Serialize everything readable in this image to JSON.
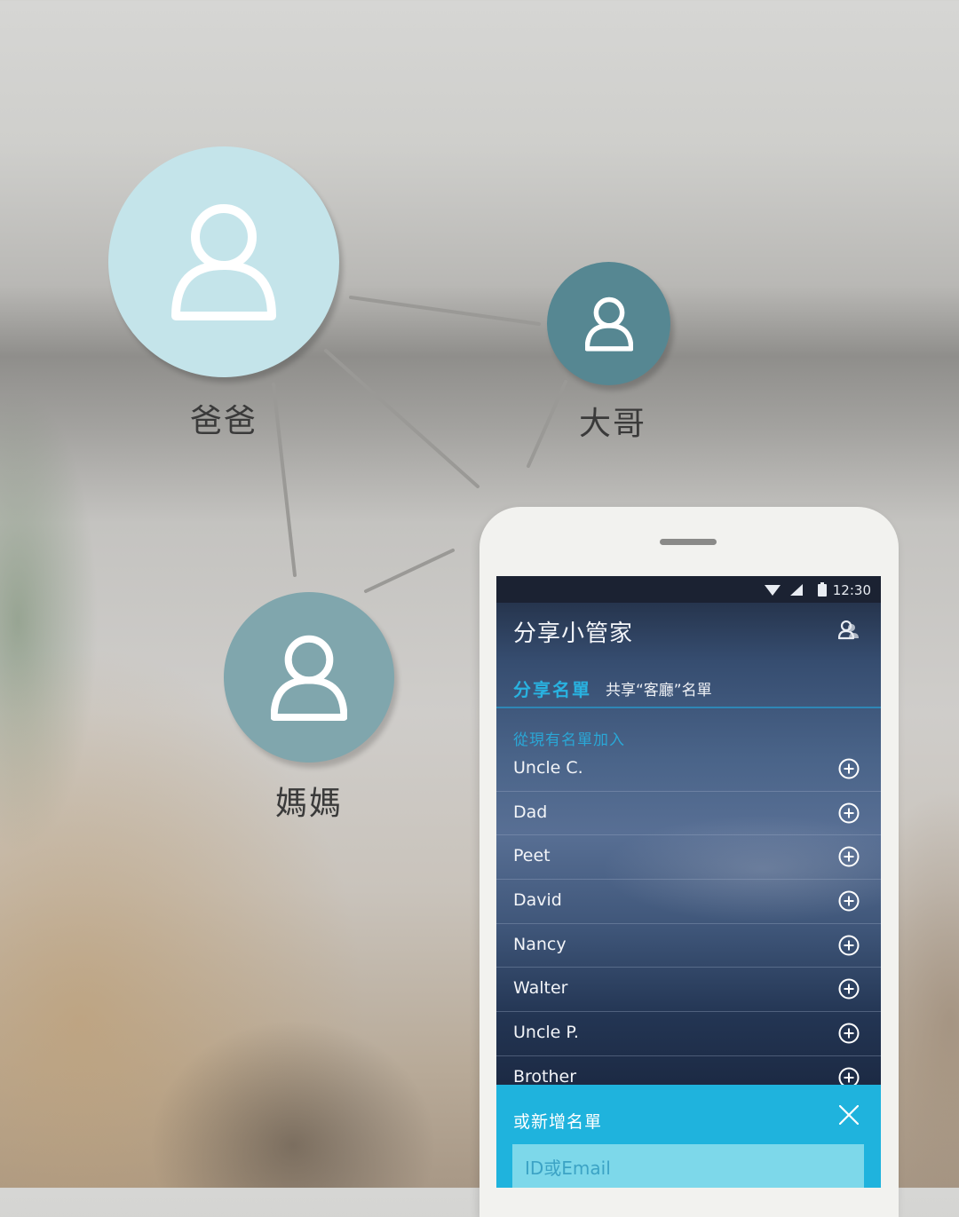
{
  "network": {
    "nodes": [
      {
        "id": "dad",
        "label": "爸爸",
        "color": "#c4e4ea"
      },
      {
        "id": "big-brother",
        "label": "大哥",
        "color": "#568792"
      },
      {
        "id": "mom",
        "label": "媽媽",
        "color": "#80a6ad"
      }
    ]
  },
  "phone": {
    "status": {
      "time": "12:30"
    },
    "app_title": "分享小管家",
    "tabs": {
      "active": "分享名單",
      "name": "共享“客廳”名單"
    },
    "section_label": "從現有名單加入",
    "contacts": [
      {
        "name": "Uncle C."
      },
      {
        "name": "Dad"
      },
      {
        "name": "Peet"
      },
      {
        "name": "David"
      },
      {
        "name": "Nancy"
      },
      {
        "name": "Walter"
      },
      {
        "name": "Uncle P."
      },
      {
        "name": "Brother"
      }
    ],
    "add_new": {
      "title": "或新增名單",
      "placeholder": "ID或Email",
      "value": ""
    },
    "icons": {
      "add": "plus-circle-icon",
      "close": "close-icon",
      "account": "account-icon"
    },
    "colors": {
      "accent": "#1fb3dd",
      "tab_active": "#29b2e0"
    }
  }
}
